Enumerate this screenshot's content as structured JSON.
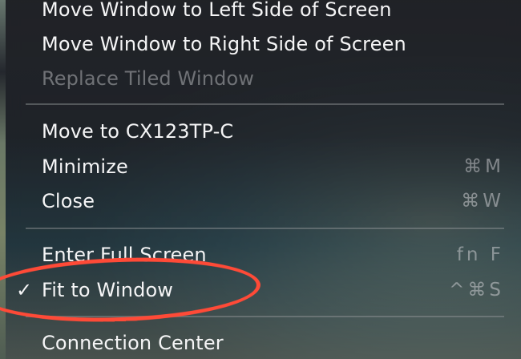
{
  "menu": {
    "items": [
      {
        "label": "Move Window to Left Side of Screen"
      },
      {
        "label": "Move Window to Right Side of Screen"
      },
      {
        "label": "Replace Tiled Window"
      },
      {
        "label": "Move to CX123TP-C"
      },
      {
        "label": "Minimize",
        "shortcut": "⌘M"
      },
      {
        "label": "Close",
        "shortcut": "⌘W"
      },
      {
        "label": "Enter Full Screen",
        "shortcut": "fn F"
      },
      {
        "label": "Fit to Window",
        "shortcut": "^⌘S",
        "checked": true,
        "check_mark": "✓"
      },
      {
        "label": "Connection Center"
      }
    ]
  },
  "annotation": {
    "color": "#ff4a37",
    "type": "ellipse"
  }
}
